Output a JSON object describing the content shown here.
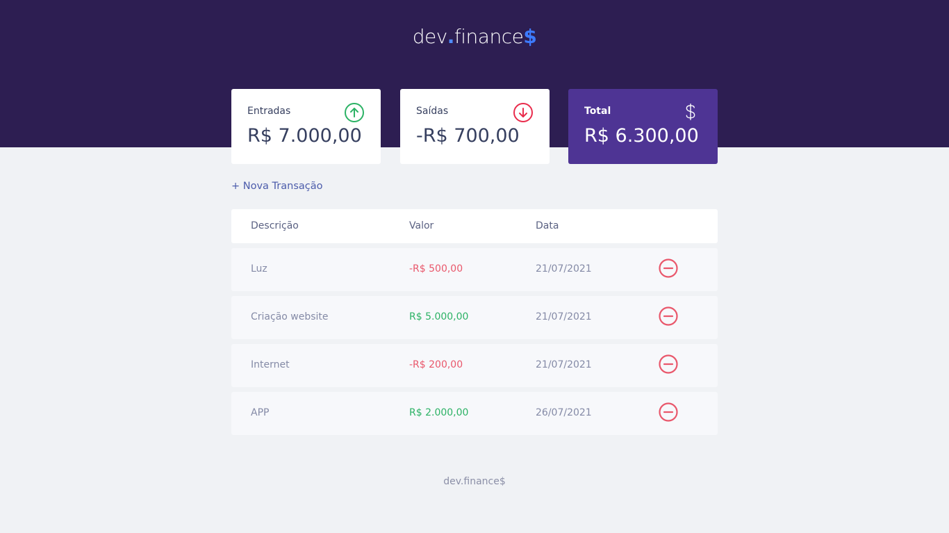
{
  "header": {
    "logo_main": "dev",
    "logo_dot": ".",
    "logo_rest": "finance",
    "logo_dollar": "$"
  },
  "cards": {
    "income": {
      "label": "Entradas",
      "value": "R$ 7.000,00",
      "icon": "arrow-up-circle-icon"
    },
    "expense": {
      "label": "Saídas",
      "value": "-R$ 700,00",
      "icon": "arrow-down-circle-icon"
    },
    "total": {
      "label": "Total",
      "value": "R$ 6.300,00",
      "icon": "dollar-sign-icon"
    }
  },
  "new_transaction_label": "+ Nova Transação",
  "table": {
    "headers": {
      "description": "Descrição",
      "amount": "Valor",
      "date": "Data"
    },
    "rows": [
      {
        "description": "Luz",
        "amount": "-R$ 500,00",
        "type": "expense",
        "date": "21/07/2021"
      },
      {
        "description": "Criação website",
        "amount": "R$ 5.000,00",
        "type": "income",
        "date": "21/07/2021"
      },
      {
        "description": "Internet",
        "amount": "-R$ 200,00",
        "type": "expense",
        "date": "21/07/2021"
      },
      {
        "description": "APP",
        "amount": "R$ 2.000,00",
        "type": "income",
        "date": "26/07/2021"
      }
    ],
    "remove_icon": "minus-circle-icon"
  },
  "footer": {
    "text": "dev.finance$"
  },
  "colors": {
    "header_bg": "#2d1e52",
    "total_card_bg": "#4e3494",
    "income": "#2cb265",
    "expense": "#e9576b",
    "link": "#4c5cab"
  }
}
